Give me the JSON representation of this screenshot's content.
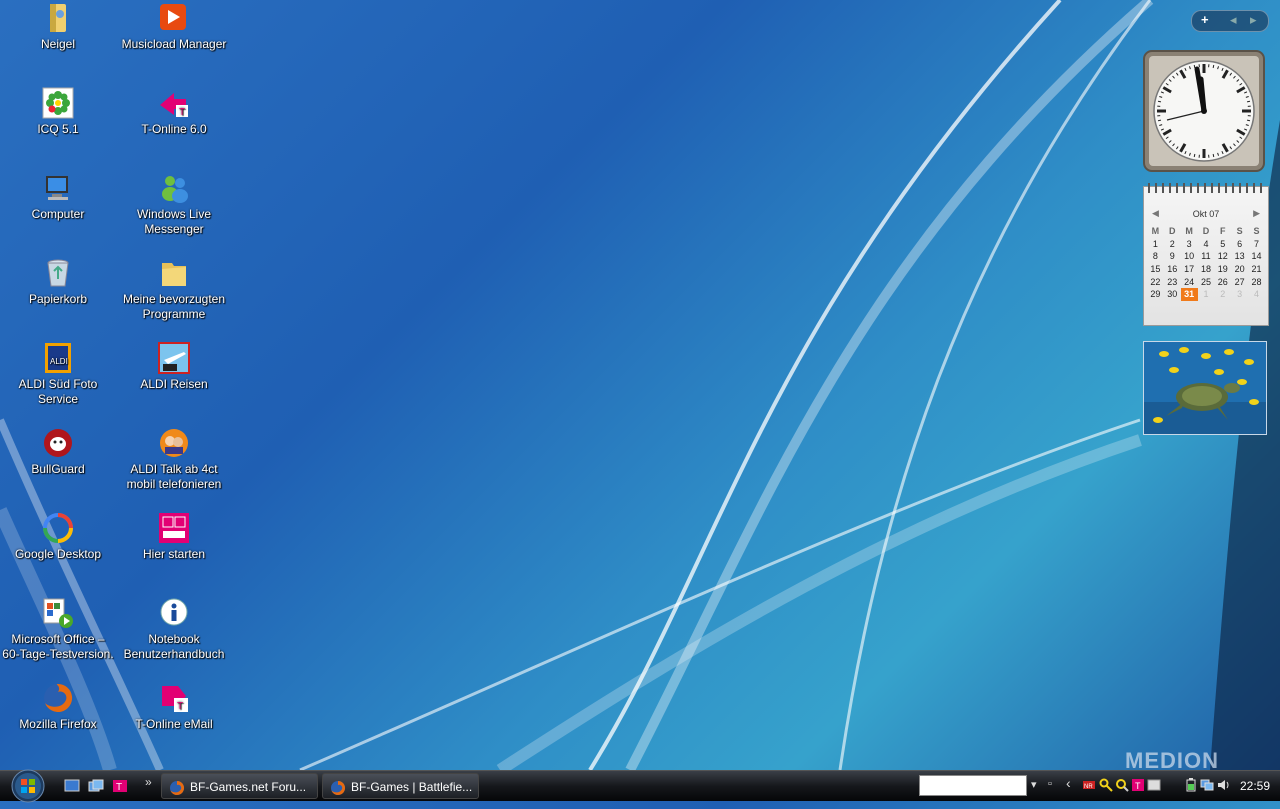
{
  "desktop": {
    "icons": [
      {
        "label": "Neigel",
        "icon": "user-folder-icon"
      },
      {
        "label": "Musicload Manager",
        "icon": "musicload-icon"
      },
      {
        "label": "ICQ 5.1",
        "icon": "icq-flower-icon"
      },
      {
        "label": "T-Online 6.0",
        "icon": "t-online-icon"
      },
      {
        "label": "Computer",
        "icon": "computer-icon"
      },
      {
        "label": "Windows Live Messenger",
        "icon": "messenger-icon"
      },
      {
        "label": "Papierkorb",
        "icon": "recycle-bin-icon"
      },
      {
        "label": "Meine bevorzugten Programme",
        "icon": "folder-icon"
      },
      {
        "label": "ALDI Süd Foto Service",
        "icon": "aldi-icon"
      },
      {
        "label": "ALDI Reisen",
        "icon": "aldi-travel-icon"
      },
      {
        "label": "BullGuard",
        "icon": "bullguard-icon"
      },
      {
        "label": "ALDI Talk ab 4ct mobil telefonieren",
        "icon": "aldi-talk-icon"
      },
      {
        "label": "Google Desktop",
        "icon": "google-desktop-icon"
      },
      {
        "label": "Hier starten",
        "icon": "t-com-icon"
      },
      {
        "label": "Microsoft Office – 60-Tage-Testversion.",
        "icon": "office-trial-icon"
      },
      {
        "label": "Notebook Benutzerhandbuch",
        "icon": "info-icon"
      },
      {
        "label": "Mozilla Firefox",
        "icon": "firefox-icon"
      },
      {
        "label": "T-Online eMail",
        "icon": "t-online-email-icon"
      }
    ],
    "brand": "MEDION"
  },
  "sidebar": {
    "add_glyph": "+",
    "prev_glyph": "◂",
    "next_glyph": "▸",
    "calendar": {
      "month_label": "Okt 07",
      "prev": "◀",
      "next": "▶",
      "weekdays": [
        "M",
        "D",
        "M",
        "D",
        "F",
        "S",
        "S"
      ],
      "weeks": [
        [
          "1",
          "2",
          "3",
          "4",
          "5",
          "6",
          "7"
        ],
        [
          "8",
          "9",
          "10",
          "11",
          "12",
          "13",
          "14"
        ],
        [
          "15",
          "16",
          "17",
          "18",
          "19",
          "20",
          "21"
        ],
        [
          "22",
          "23",
          "24",
          "25",
          "26",
          "27",
          "28"
        ],
        [
          "29",
          "30",
          "31",
          "1",
          "2",
          "3",
          "4"
        ]
      ],
      "today": "31"
    }
  },
  "taskbar": {
    "more_glyph": "»",
    "tasks": [
      {
        "label": "BF-Games.net Foru...",
        "icon": "firefox-icon"
      },
      {
        "label": "BF-Games | Battlefie...",
        "icon": "firefox-icon"
      }
    ],
    "collapse_glyph": "‹",
    "time": "22:59"
  },
  "colors": {
    "today": "#f07a1a",
    "taskbar": "#16181c",
    "accent": "#2a6fc0"
  }
}
